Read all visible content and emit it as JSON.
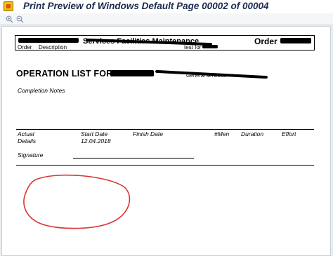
{
  "window": {
    "title": "Print Preview of Windows Default Page 00002 of 00004"
  },
  "toolbar": {
    "icons": [
      "zoom-in-icon",
      "zoom-out-icon"
    ]
  },
  "document": {
    "header": {
      "title": "Services Facilities  Maintenance",
      "order_label": "Order",
      "col_order": "Order",
      "col_description": "Description",
      "test_text": "test  for"
    },
    "operation_list_label": "OPERATION LIST FOR  :",
    "operation_detail": "General services",
    "completion_notes": "Completion Notes",
    "columns": {
      "actual": "Actual",
      "start_date": "Start  Date",
      "finish_date": "Finish  Date",
      "men": "#Men",
      "duration": "Duration",
      "effort": "Effort"
    },
    "details_label": "Details",
    "start_date_value": "12.04.2018",
    "signature_label": "Signature"
  },
  "colors": {
    "annotation": "#d93636",
    "title_text": "#1a2b4d"
  }
}
